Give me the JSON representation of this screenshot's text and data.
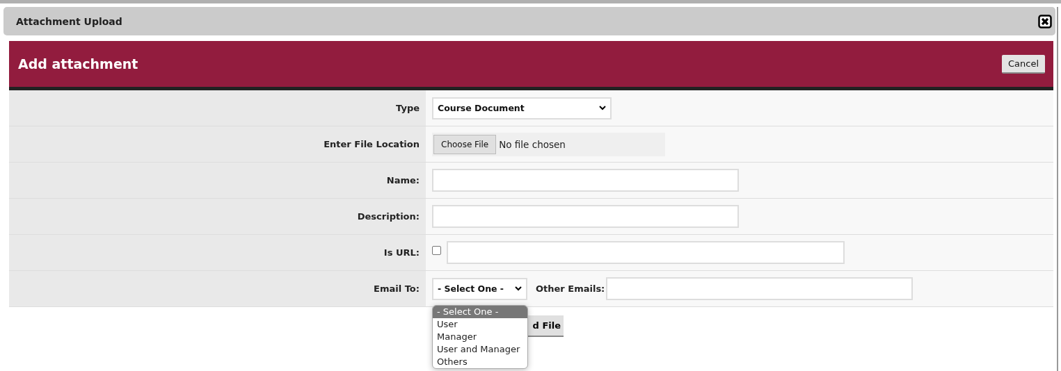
{
  "window": {
    "title": "Attachment Upload"
  },
  "header": {
    "title": "Add attachment",
    "cancel": "Cancel"
  },
  "rows": [
    {
      "kind": "select",
      "label": "Type",
      "value": "Course Document"
    },
    {
      "kind": "file",
      "label": "Enter File Location",
      "button": "Choose File",
      "status": "No file chosen"
    },
    {
      "kind": "text",
      "label": "Name:"
    },
    {
      "kind": "text",
      "label": "Description:"
    },
    {
      "kind": "url",
      "label": "Is URL:",
      "checked": false
    },
    {
      "kind": "email",
      "label": "Email To:",
      "value": "- Select One -",
      "other_label": "Other Emails:"
    }
  ],
  "upload_button": "d File",
  "dropdown": {
    "options": [
      {
        "label": "- Select One -",
        "selected": true
      },
      {
        "label": "User",
        "selected": false
      },
      {
        "label": "Manager",
        "selected": false
      },
      {
        "label": "User and Manager",
        "selected": false
      },
      {
        "label": "Others",
        "selected": false
      }
    ]
  }
}
